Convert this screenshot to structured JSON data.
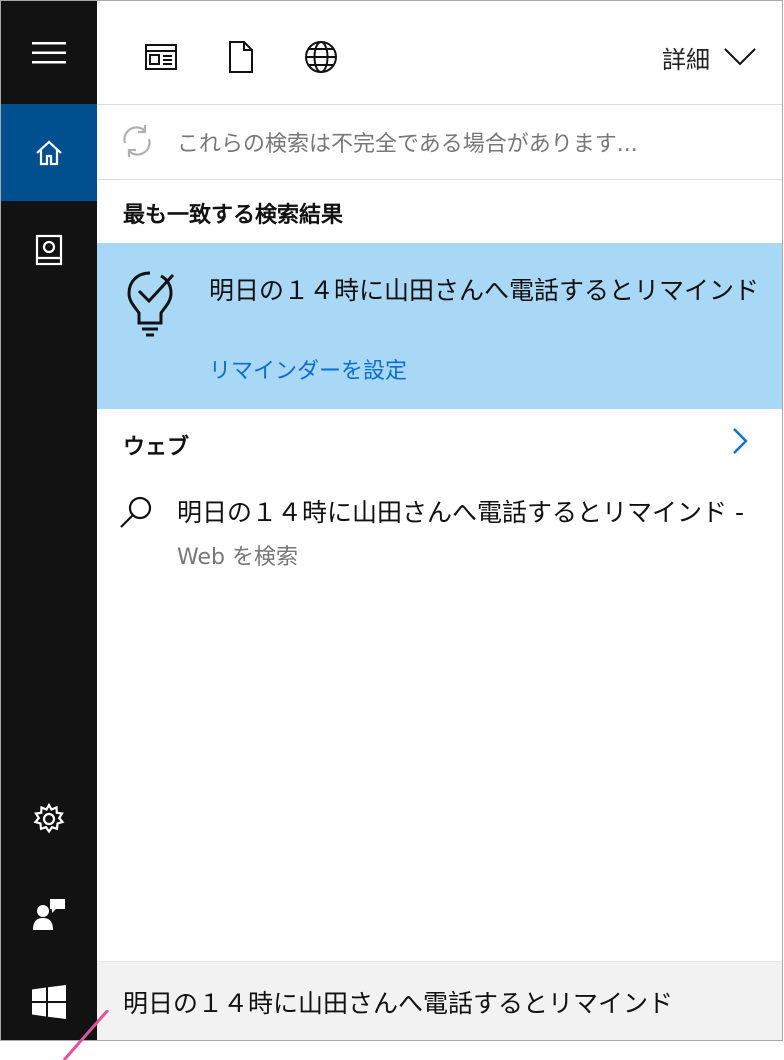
{
  "toolbar": {
    "details_label": "詳細",
    "icons": [
      "news-icon",
      "document-icon",
      "globe-icon",
      "chevron-down-icon"
    ]
  },
  "rail": {
    "items": [
      "hamburger-menu-icon",
      "home-icon",
      "notebook-icon",
      "gear-icon",
      "feedback-icon"
    ],
    "active": "home-icon"
  },
  "warning": {
    "text": "これらの検索は不完全である場合があります..."
  },
  "best_match": {
    "heading": "最も一致する検索結果",
    "title": "明日の１４時に山田さんへ電話するとリマインド",
    "action": "リマインダーを設定"
  },
  "web": {
    "heading": "ウェブ",
    "query": "明日の１４時に山田さんへ電話するとリマインド -",
    "subtitle": "Web を検索"
  },
  "search": {
    "value": "明日の１４時に山田さんへ電話するとリマインド"
  },
  "colors": {
    "rail": "#121212",
    "active": "#00508f",
    "highlight": "#a9d7f6",
    "link": "#0a6fd1",
    "annotation": "#e0529c"
  }
}
